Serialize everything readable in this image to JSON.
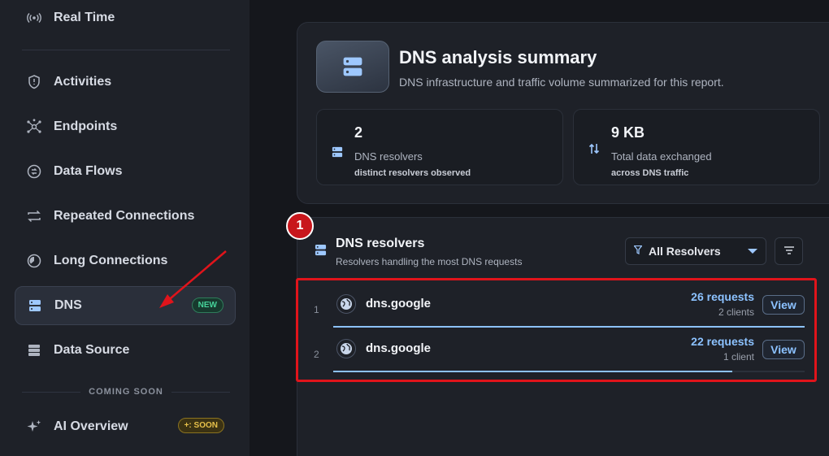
{
  "sidebar": {
    "items": [
      {
        "label": "Real Time",
        "icon": "broadcast-icon"
      },
      {
        "label": "Activities",
        "icon": "shield-icon"
      },
      {
        "label": "Endpoints",
        "icon": "network-icon"
      },
      {
        "label": "Data Flows",
        "icon": "flow-icon"
      },
      {
        "label": "Repeated Connections",
        "icon": "repeat-icon"
      },
      {
        "label": "Long Connections",
        "icon": "clock-icon"
      },
      {
        "label": "DNS",
        "icon": "server-icon",
        "badge": "NEW",
        "active": true
      },
      {
        "label": "Data Source",
        "icon": "database-icon"
      },
      {
        "label": "AI Overview",
        "icon": "sparkle-icon",
        "badge": "SOON"
      }
    ],
    "coming_soon_label": "COMING SOON",
    "soon_badge_prefix": "+:"
  },
  "summary": {
    "title": "DNS analysis summary",
    "subtitle": "DNS infrastructure and traffic volume summarized for this report.",
    "stats": [
      {
        "value": "2",
        "label": "DNS resolvers",
        "sub": "distinct resolvers observed",
        "icon": "server-icon"
      },
      {
        "value": "9 KB",
        "label": "Total data exchanged",
        "sub": "across DNS traffic",
        "icon": "transfer-icon"
      }
    ]
  },
  "resolvers": {
    "title": "DNS resolvers",
    "subtitle": "Resolvers handling the most DNS requests",
    "filter_label": "All Resolvers",
    "rows": [
      {
        "rank": "1",
        "host": "dns.google",
        "requests": "26 requests",
        "clients": "2 clients",
        "view_label": "View",
        "share": 1.0
      },
      {
        "rank": "2",
        "host": "dns.google",
        "requests": "22 requests",
        "clients": "1 client",
        "view_label": "View",
        "share": 0.846
      }
    ]
  },
  "annotation": {
    "marker_label": "1",
    "color": "#e0141b"
  },
  "colors": {
    "accent": "#8cc2ff",
    "background": "#15171c",
    "panel": "#1e2128",
    "new_badge": "#46d39a",
    "soon_badge": "#e6c04a"
  }
}
